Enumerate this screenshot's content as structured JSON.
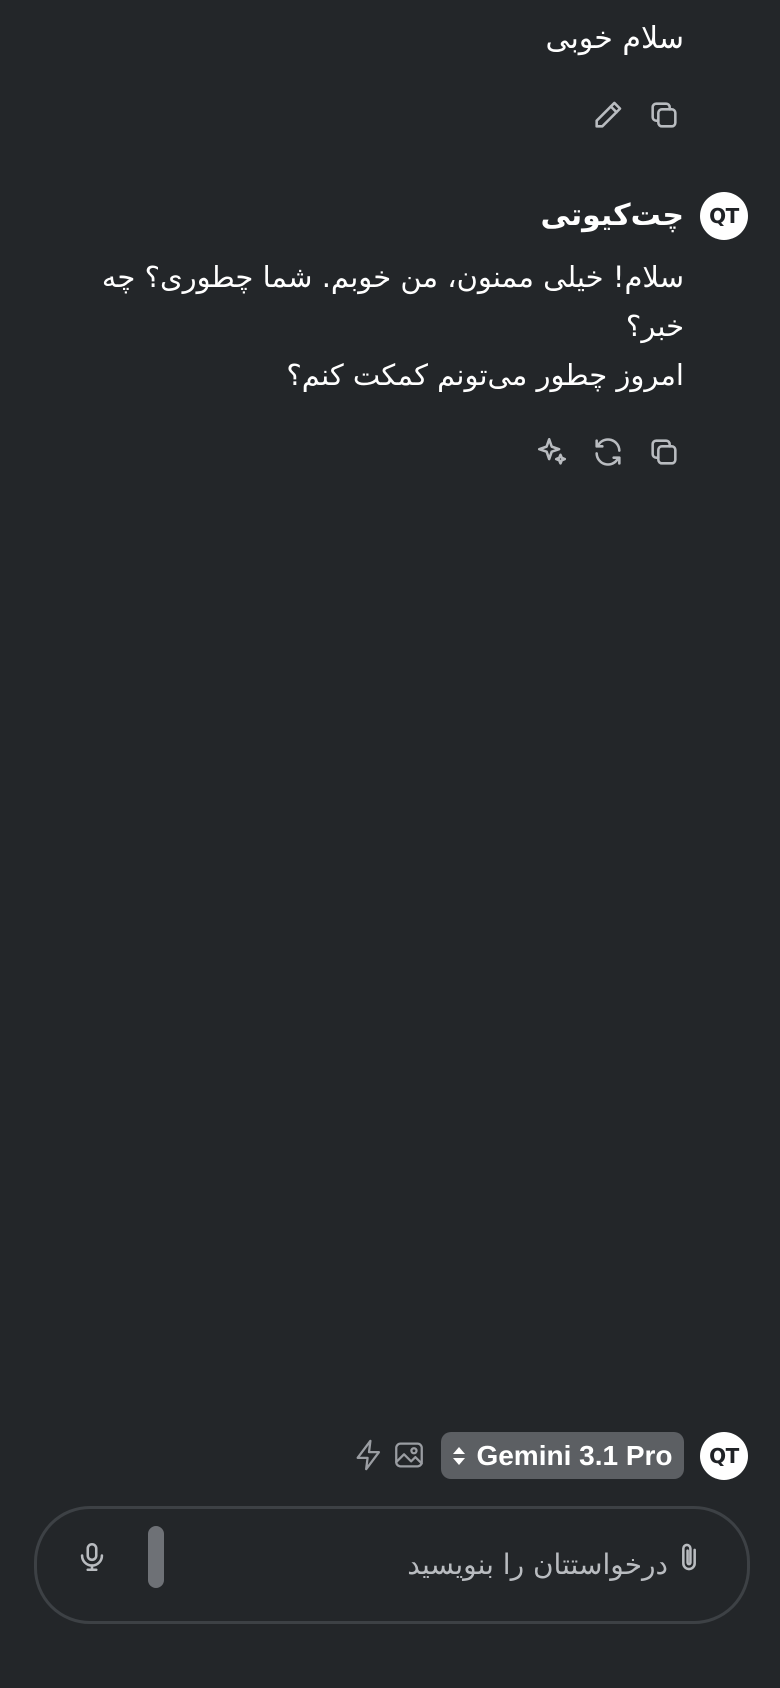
{
  "user_message": {
    "text": "سلام خوبی"
  },
  "bot": {
    "avatar_text": "QT",
    "name": "چت‌کیوتی",
    "lines": [
      "سلام! خیلی ممنون، من خوبم. شما چطوری؟ چه خبر؟",
      "امروز چطور می‌تونم کمکت کنم؟"
    ]
  },
  "toolbar": {
    "avatar_text": "QT",
    "model_label": "Gemini 3.1 Pro"
  },
  "composer": {
    "placeholder": "درخواستتان را بنویسید"
  },
  "icons": {
    "user_actions": [
      "pencil-icon",
      "copy-icon"
    ],
    "bot_actions": [
      "sparkles-icon",
      "regenerate-icon",
      "copy-icon"
    ],
    "toolbar": [
      "lightning-icon",
      "image-icon",
      "chevron-updown-icon"
    ],
    "composer": [
      "microphone-icon",
      "paperclip-icon"
    ]
  },
  "colors": {
    "background": "#232629",
    "icon_gray": "#b9bcc0",
    "pill": "#5c5f63",
    "composer_border": "#3d4145"
  }
}
